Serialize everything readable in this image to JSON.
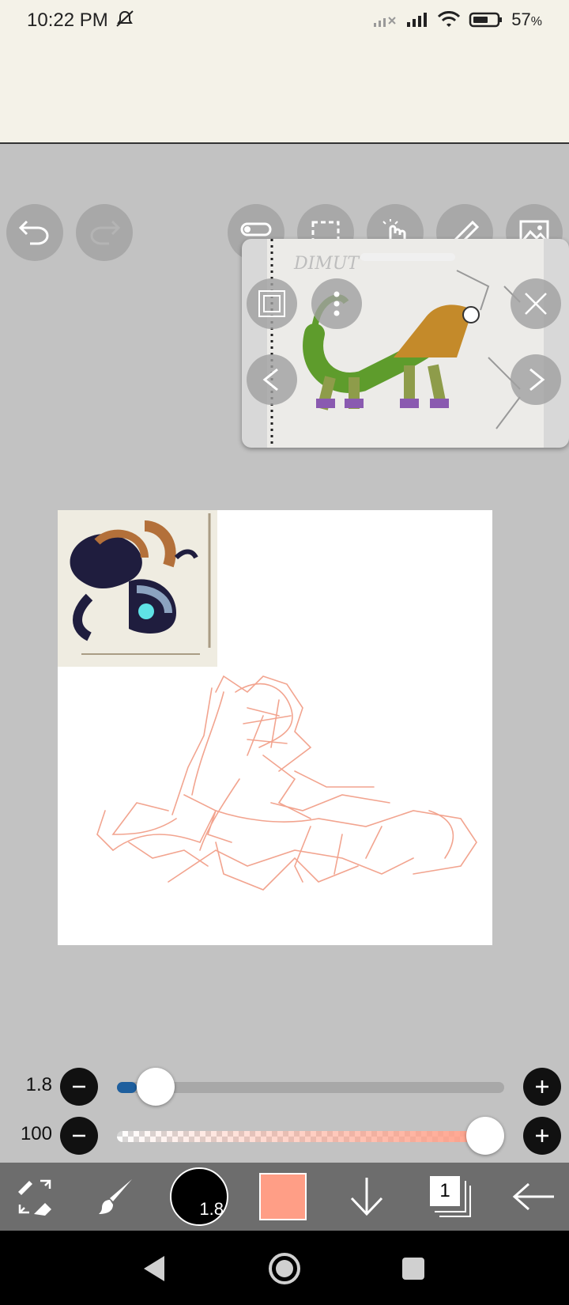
{
  "status": {
    "time": "10:22 PM",
    "battery": "57",
    "battery_unit": "%"
  },
  "top_icons": [
    "undo-icon",
    "redo-icon",
    "toggle-icon",
    "selection-icon",
    "hand-icon",
    "ruler-icon",
    "image-icon"
  ],
  "brush_size": {
    "label": "1.8",
    "value": 1.8,
    "fraction": 0.05
  },
  "opacity": {
    "label": "100",
    "value": 100,
    "fraction": 1.0
  },
  "toolbar": {
    "brush_size_label": "1.8",
    "layer_count": "1",
    "current_color": "#ff9e86"
  },
  "colors": {
    "sketch_stroke": "#f2a48f",
    "status_bg": "#f4f2e8",
    "workspace_bg": "#c2c2c2"
  }
}
